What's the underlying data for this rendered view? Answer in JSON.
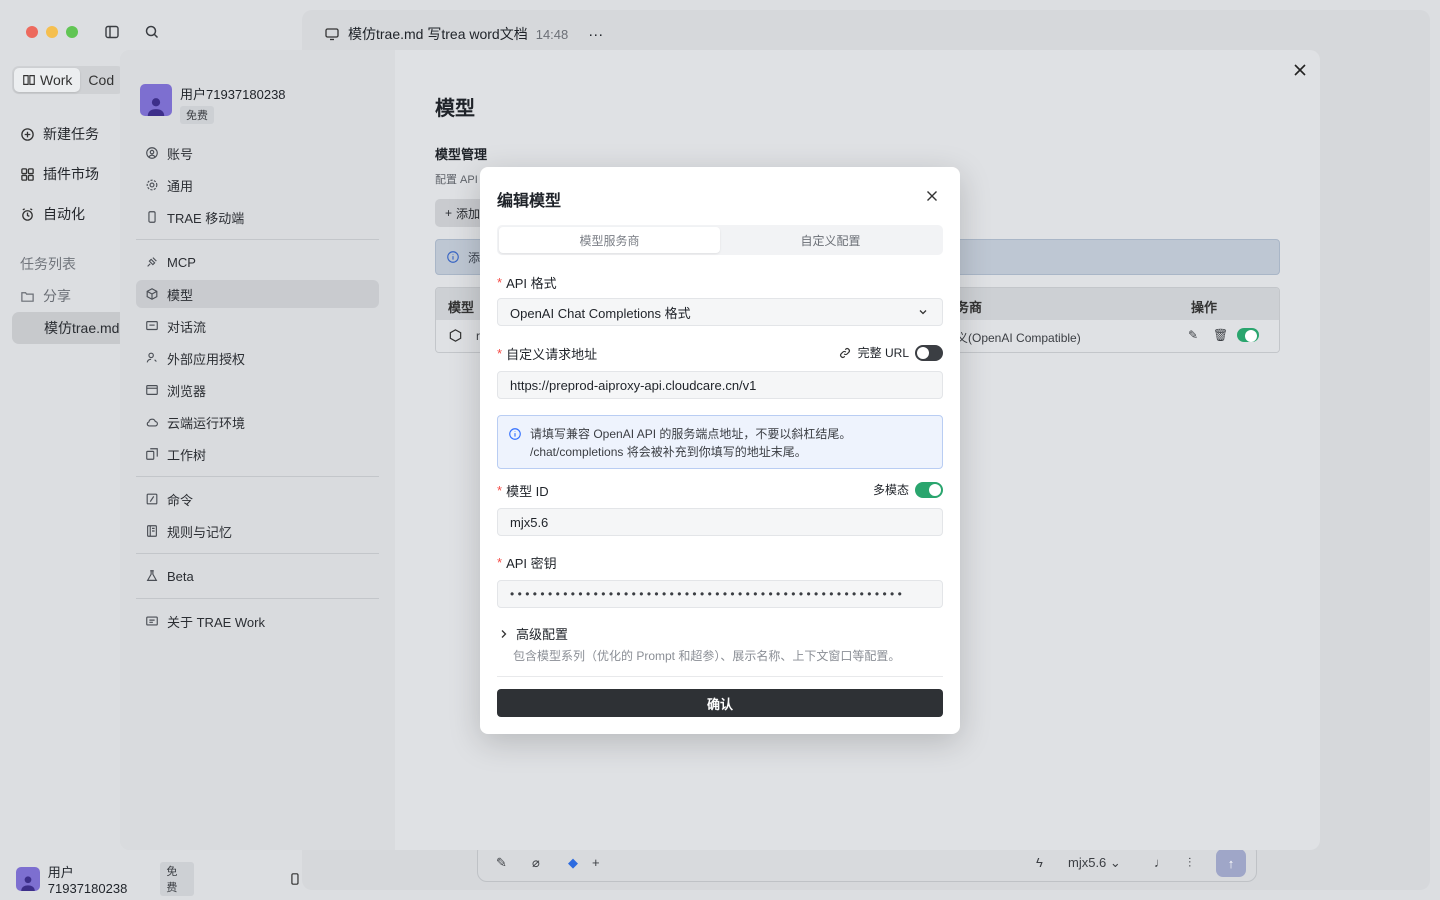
{
  "window": {
    "chat_title": "模仿trae.md 写trea word文档",
    "chat_time": "14:48",
    "more": "···"
  },
  "left_sidebar": {
    "mode_tabs": [
      "Work",
      "Cod"
    ],
    "nav": [
      "新建任务",
      "插件市场",
      "自动化"
    ],
    "task_list_label": "任务列表",
    "share_label": "分享",
    "task_item": "模仿trae.md",
    "user_name": "用户71937180238",
    "plan": "免费"
  },
  "composer": {
    "model": "mjx5.6",
    "chevron": "⌄"
  },
  "settings": {
    "user_name": "用户71937180238",
    "plan": "免费",
    "menu": [
      {
        "label": "账号",
        "icon": "account-icon"
      },
      {
        "label": "通用",
        "icon": "gear-icon"
      },
      {
        "label": "TRAE 移动端",
        "icon": "phone-icon"
      },
      {
        "label": "MCP",
        "icon": "plug-icon"
      },
      {
        "label": "模型",
        "icon": "cube-icon"
      },
      {
        "label": "对话流",
        "icon": "chat-icon"
      },
      {
        "label": "外部应用授权",
        "icon": "user-key-icon"
      },
      {
        "label": "浏览器",
        "icon": "browser-icon"
      },
      {
        "label": "云端运行环境",
        "icon": "cloud-icon"
      },
      {
        "label": "工作树",
        "icon": "tree-icon"
      },
      {
        "label": "命令",
        "icon": "command-icon"
      },
      {
        "label": "规则与记忆",
        "icon": "book-icon"
      },
      {
        "label": "Beta",
        "icon": "flask-icon"
      },
      {
        "label": "关于 TRAE Work",
        "icon": "info-card-icon"
      }
    ],
    "main_title": "模型",
    "section_title": "模型管理",
    "section_desc": "配置 API",
    "add_button": "添加",
    "notice_text": "添",
    "table_headers": [
      "模型",
      "务商",
      "操作"
    ],
    "row_model": "r",
    "row_provider": "义(OpenAI Compatible)"
  },
  "modal": {
    "title": "编辑模型",
    "tabs": [
      "模型服务商",
      "自定义配置"
    ],
    "api_format_label": "API 格式",
    "api_format_value": "OpenAI Chat Completions 格式",
    "url_label": "自定义请求地址",
    "full_url_label": "完整 URL",
    "full_url_enabled": false,
    "url_value": "https://preprod-aiproxy-api.cloudcare.cn/v1",
    "info_line1": "请填写兼容 OpenAI API 的服务端点地址，不要以斜杠结尾。",
    "info_line2": "/chat/completions 将会被补充到你填写的地址末尾。",
    "model_id_label": "模型 ID",
    "multimodal_label": "多模态",
    "multimodal_enabled": true,
    "model_id_value": "mjx5.6",
    "api_key_label": "API 密钥",
    "api_key_masked": "••••••••••••••••••••••••••••••••••••••••••••••••••••",
    "advanced_label": "高级配置",
    "advanced_desc": "包含模型系列（优化的 Prompt 和超参）、展示名称、上下文窗口等配置。",
    "confirm_button": "确认"
  }
}
